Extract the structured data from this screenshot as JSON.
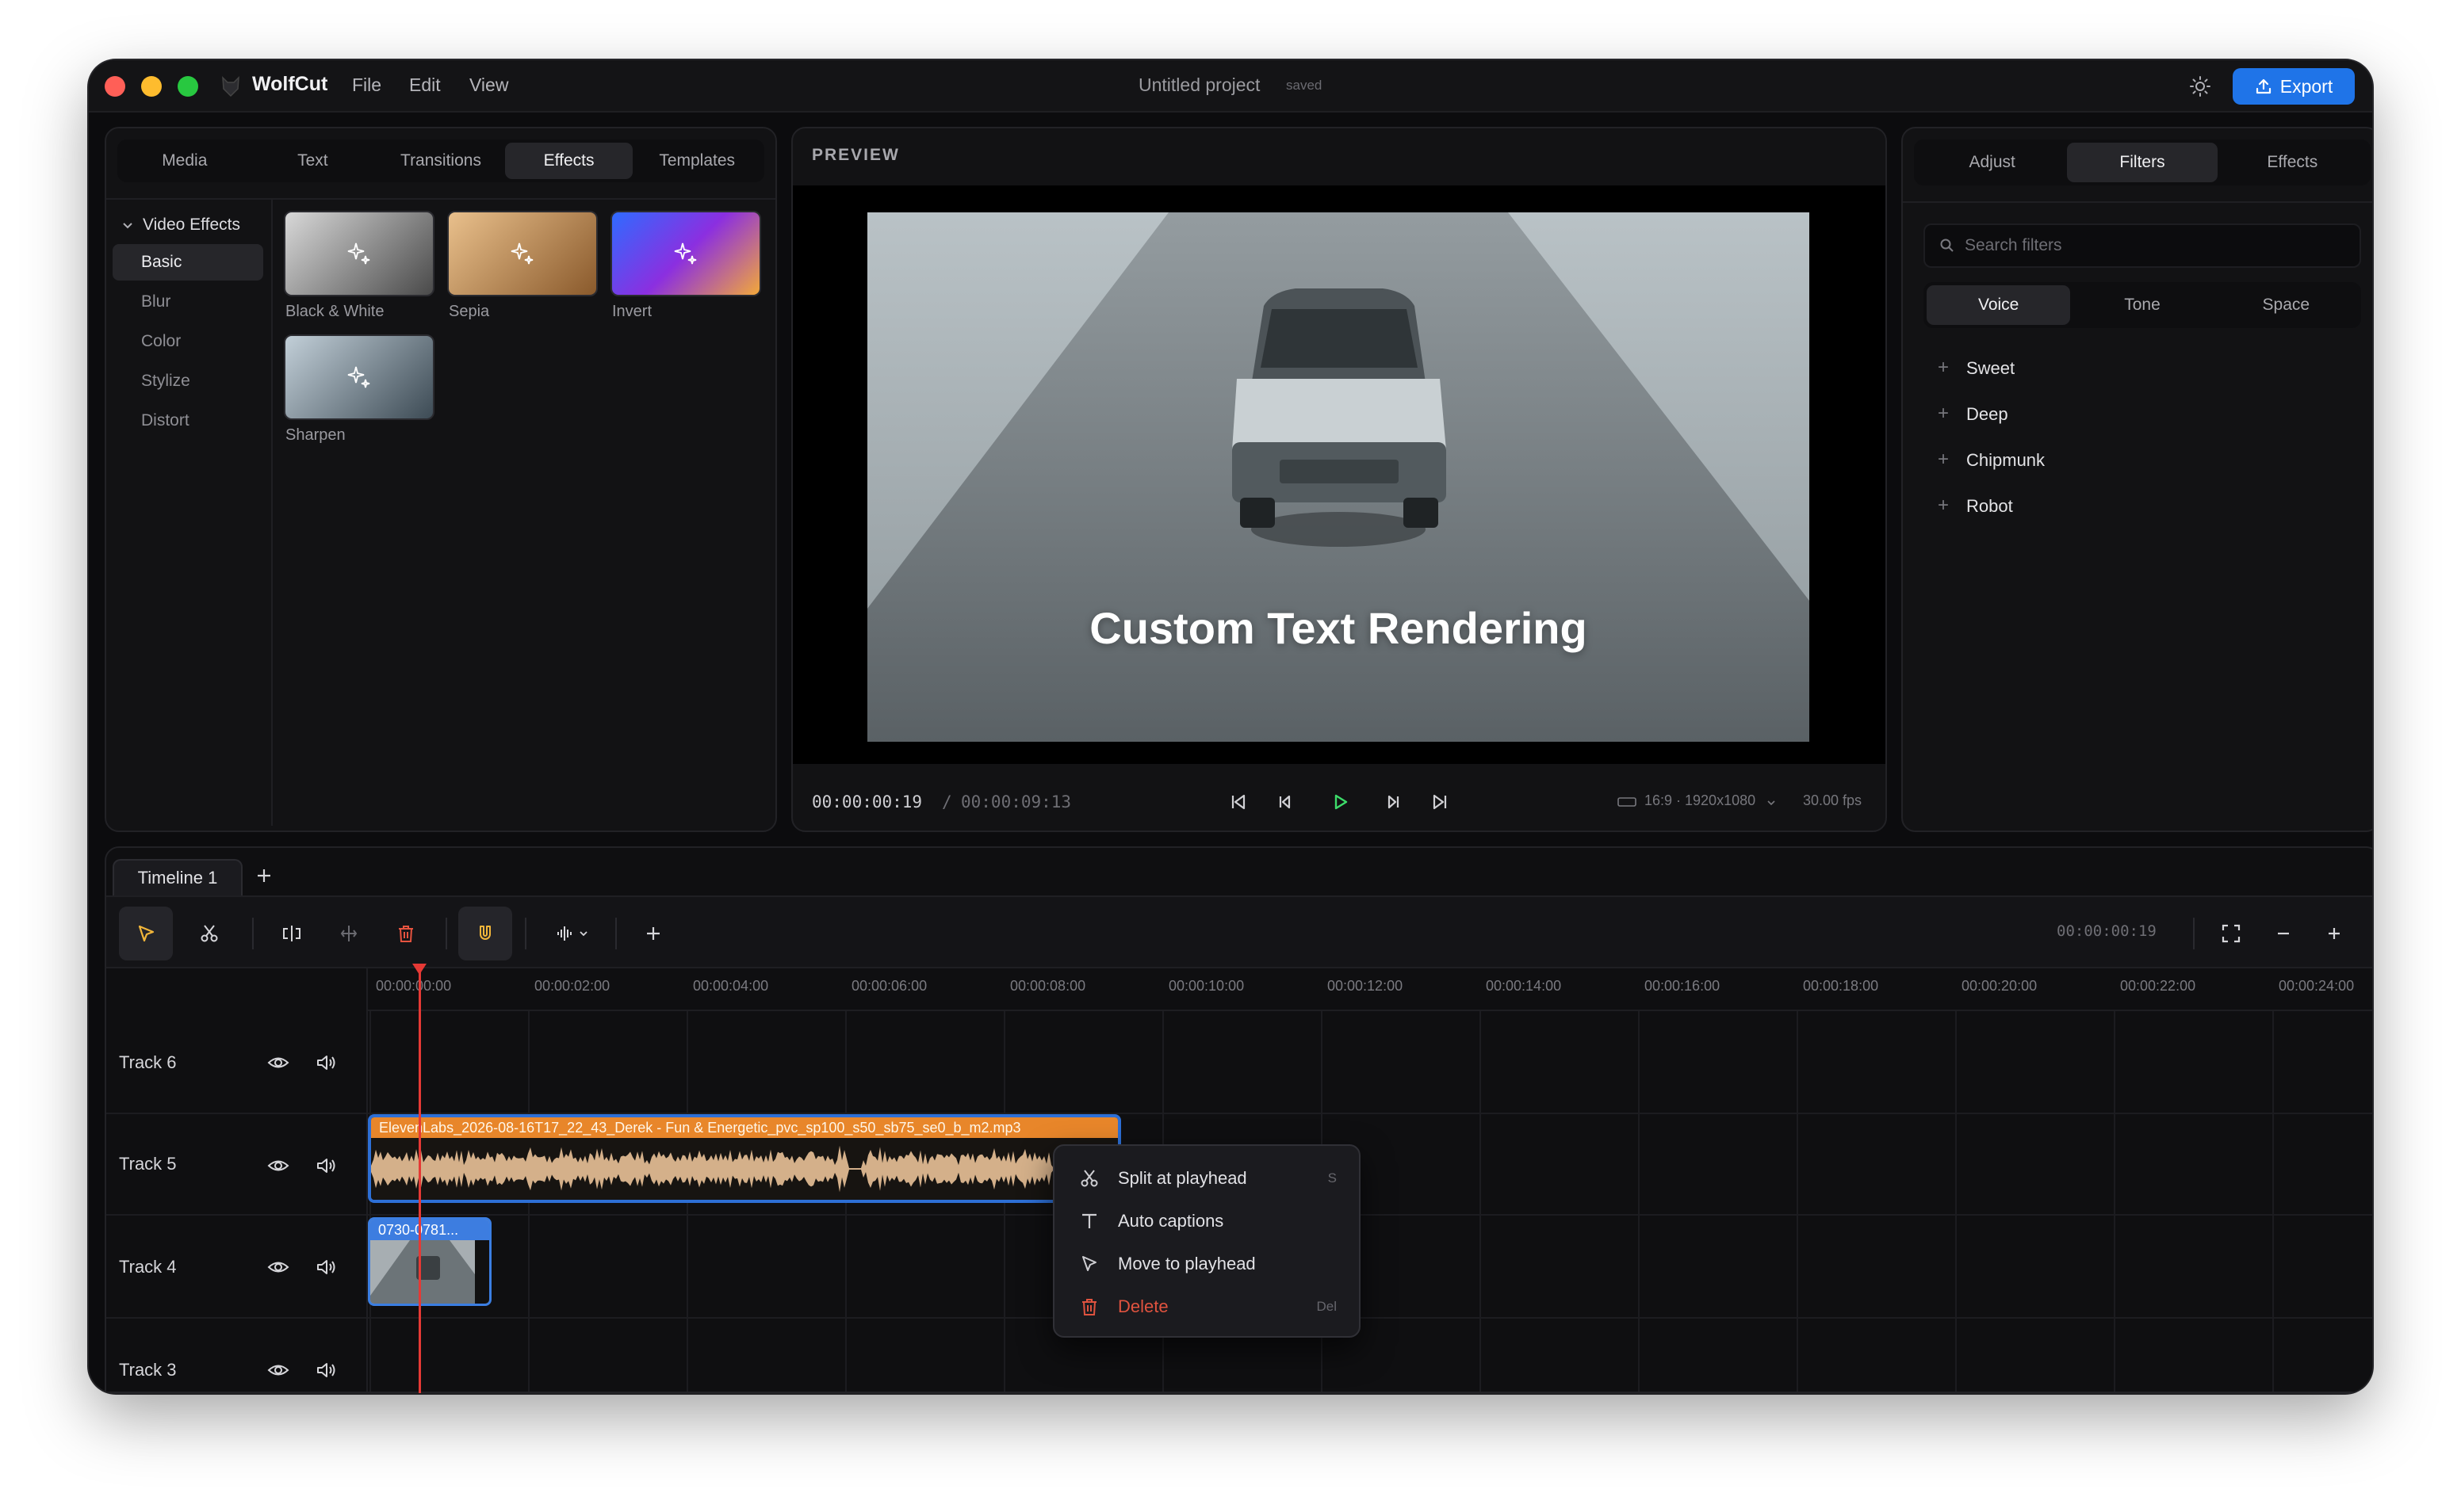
{
  "titlebar": {
    "app_name": "WolfCut",
    "menu": [
      "File",
      "Edit",
      "View"
    ],
    "project_title": "Untitled project",
    "save_status": "saved",
    "export_label": "Export",
    "colors": {
      "close": "#ff5f57",
      "minimize": "#febc2e",
      "maximize": "#28c840",
      "accent": "#1f74e8"
    }
  },
  "left_panel": {
    "tabs": [
      "Media",
      "Text",
      "Transitions",
      "Effects",
      "Templates"
    ],
    "active_tab": "Effects",
    "section_title": "Video Effects",
    "categories": [
      "Basic",
      "Blur",
      "Color",
      "Stylize",
      "Distort"
    ],
    "active_category": "Basic",
    "effects": [
      "Black & White",
      "Sepia",
      "Invert",
      "Sharpen"
    ]
  },
  "preview": {
    "title": "PREVIEW",
    "caption": "Custom Text Rendering",
    "current_time": "00:00:00:19",
    "separator": "/",
    "total_time": "00:00:09:13",
    "aspect": "16:9 · 1920x1080",
    "fps": "30.00 fps"
  },
  "right_panel": {
    "tabs": [
      "Adjust",
      "Filters",
      "Effects"
    ],
    "active_tab": "Filters",
    "search_placeholder": "Search filters",
    "subtabs": [
      "Voice",
      "Tone",
      "Space"
    ],
    "active_subtab": "Voice",
    "filters": [
      "Sweet",
      "Deep",
      "Chipmunk",
      "Robot"
    ]
  },
  "timeline": {
    "tab_label": "Timeline 1",
    "timecode": "00:00:00:19",
    "ruler": [
      "00:00:00:00",
      "00:00:02:00",
      "00:00:04:00",
      "00:00:06:00",
      "00:00:08:00",
      "00:00:10:00",
      "00:00:12:00",
      "00:00:14:00",
      "00:00:16:00",
      "00:00:18:00",
      "00:00:20:00",
      "00:00:22:00",
      "00:00:24:00"
    ],
    "tracks": [
      "Track 6",
      "Track 5",
      "Track 4",
      "Track 3"
    ],
    "audio_clip_name": "ElevenLabs_2026-08-16T17_22_43_Derek - Fun & Energetic_pvc_sp100_s50_sb75_se0_b_m2.mp3",
    "video_clip_name": "0730-0781..."
  },
  "context_menu": {
    "items": [
      {
        "label": "Split at playhead",
        "shortcut": "S",
        "icon": "scissors-icon"
      },
      {
        "label": "Auto captions",
        "shortcut": "",
        "icon": "text-t-icon"
      },
      {
        "label": "Move to playhead",
        "shortcut": "",
        "icon": "cursor-arrow-icon"
      },
      {
        "label": "Delete",
        "shortcut": "Del",
        "icon": "trash-icon"
      }
    ],
    "delete_color": "#e0533f"
  }
}
